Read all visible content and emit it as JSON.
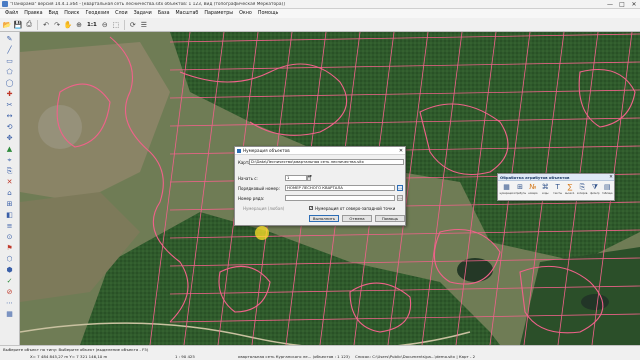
{
  "window": {
    "title": "\"Панорама\" версия 14.4.1.x64 - [квартальная сеть лесничества.sitx объектов: 1 123, Вид (топографическая Меркатора)]",
    "buttons": {
      "minimize": "—",
      "maximize": "□",
      "close": "✕"
    }
  },
  "menu": {
    "items": [
      "Файл",
      "Правка",
      "Вид",
      "Поиск",
      "Геодезия",
      "Слои",
      "Задачи",
      "База",
      "Масштаб",
      "Параметры",
      "Окно",
      "Помощь"
    ]
  },
  "toolbar": {
    "icons": [
      "folder-open-icon",
      "save-icon",
      "print-icon",
      "arrow-icon",
      "arrow-icon",
      "pan-icon",
      "zoom-in-icon",
      "zoom-out-icon",
      "zoom-window-icon",
      "layers-icon"
    ],
    "scale_label": "1:1",
    "icon_glyphs": {
      "folder": "📂",
      "save": "💾",
      "print": "⎙",
      "back": "↶",
      "forward": "↷",
      "hand": "✋",
      "zoom_in": "⊕",
      "zoom_out": "⊖",
      "zoom_window": "⬚",
      "refresh": "⟳",
      "layers": "☰"
    }
  },
  "left_tools": {
    "glyphs": [
      "✎",
      "╱",
      "▭",
      "⬠",
      "◯",
      "✚",
      "✂",
      "↔",
      "⟲",
      "✥",
      "▲",
      "⌖",
      "⎘",
      "✕",
      "⌂",
      "⊞",
      "◧",
      "≡",
      "⊙",
      "⚑",
      "⬡",
      "⬢",
      "✓",
      "⊘",
      "⋯",
      "▦"
    ]
  },
  "dialog": {
    "title": "Нумерация объектов",
    "close": "✕",
    "map_label": "Карта:",
    "map_value": "D:\\Data\\Лесничество\\квартальная сеть лесничества.sitx",
    "start_label": "Начать с:",
    "start_value": "1",
    "ordinal_label": "Порядковый номер:",
    "ordinal_value": "НОМЕР ЛЕСНОГО КВАРТАЛА",
    "series_label": "Номер ряда:",
    "series_value": "",
    "numbering_mode_label": "Нумерация (любая)",
    "northwest_label": "Нумерация от северо-западной точки",
    "northwest_checked": true,
    "check_mark": "✓",
    "run_button": "Выполнить",
    "cancel_button": "Отмена",
    "help_button": "Помощь",
    "pick_glyph": "…"
  },
  "attr_panel": {
    "title": "Обработка атрибутов объектов",
    "close": "✕",
    "tools": [
      {
        "icon": "grid-numbering-icon",
        "glyph": "▦",
        "label": "нумерация"
      },
      {
        "icon": "attribute-icon",
        "glyph": "⊞",
        "label": "атрибуты"
      },
      {
        "icon": "numbers-icon",
        "glyph": "№",
        "label": "номера"
      },
      {
        "icon": "code-icon",
        "glyph": "⌘",
        "label": "коды"
      },
      {
        "icon": "text-icon",
        "glyph": "T",
        "label": "тексты"
      },
      {
        "icon": "calc-icon",
        "glyph": "∑",
        "label": "вычисл."
      },
      {
        "icon": "copy-icon",
        "glyph": "⎘",
        "label": "копиров."
      },
      {
        "icon": "filter-icon",
        "glyph": "⧩",
        "label": "фильтр"
      },
      {
        "icon": "table-icon",
        "glyph": "▤",
        "label": "таблица"
      }
    ]
  },
  "status": {
    "hint": "Выберите объект по типу: Выберите объект (выделение объекта - F5)",
    "coords": "X= 7 484 845,27 m   Y= 7 321 146,10 m",
    "scale": "1 : 90 425",
    "map_name": "квартальная сеть Курганского ле... (объектов : 1 123)",
    "path": "Список: C:\\Users\\Public\\Documents\\pa...\\demo.sitx | Карт - 2"
  },
  "colors": {
    "parcel_outline": "#f0628a",
    "forest_dark": "#2f5a2c",
    "field_light": "#6f7c55",
    "dialog_bg": "#f0f0f0",
    "accent": "#2d6db5"
  }
}
